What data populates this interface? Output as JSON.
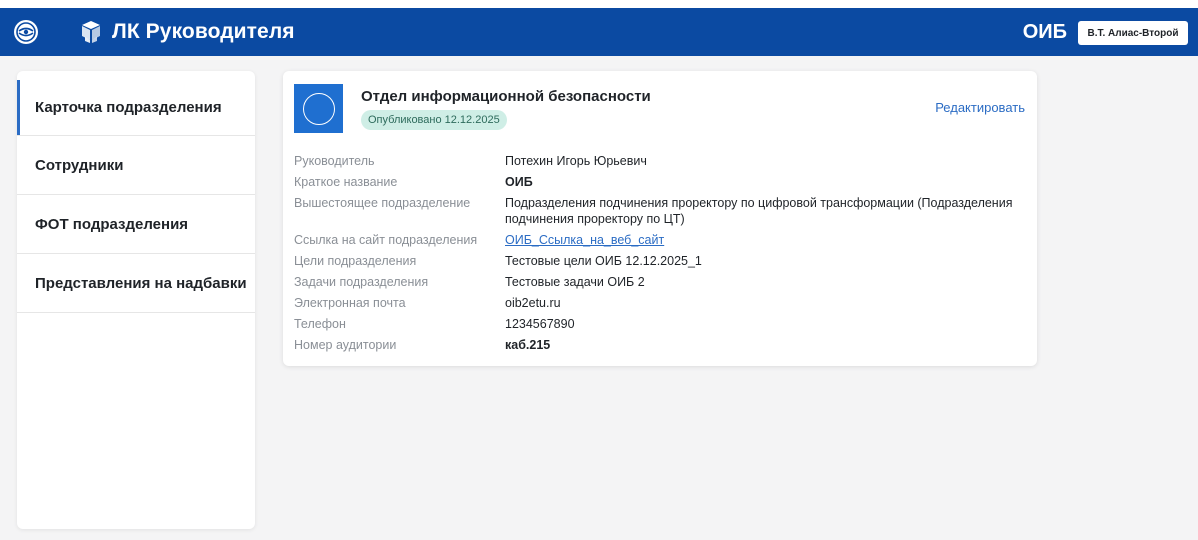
{
  "header": {
    "app_title": "ЛК Руководителя",
    "unit_code": "ОИБ",
    "user_name": "В.Т. Алиас-Второй",
    "brand_color": "#0b4aa2"
  },
  "sidebar": {
    "items": [
      {
        "label": "Карточка подразделения",
        "active": true
      },
      {
        "label": "Сотрудники"
      },
      {
        "label": "ФОТ подразделения"
      },
      {
        "label": "Представления на надбавки"
      }
    ]
  },
  "card": {
    "title": "Отдел информационной безопасности",
    "status_badge": "Опубликовано 12.12.2025",
    "edit_label": "Редактировать",
    "fields": [
      {
        "label": "Руководитель",
        "value": "Потехин Игорь Юрьевич"
      },
      {
        "label": "Краткое название",
        "value": "ОИБ"
      },
      {
        "label": "Вышестоящее подразделение",
        "value": "Подразделения подчинения проректору по цифровой трансформации (Подразделения подчинения проректору по ЦТ)"
      },
      {
        "label": "Ссылка на сайт подразделения",
        "value": "ОИБ_Ссылка_на_веб_сайт"
      },
      {
        "label": "Цели подразделения",
        "value": "Тестовые цели ОИБ 12.12.2025_1"
      },
      {
        "label": "Задачи подразделения",
        "value": "Тестовые задачи ОИБ 2"
      },
      {
        "label": "Электронная почта",
        "value": "oib2etu.ru"
      },
      {
        "label": "Телефон",
        "value": "1234567890"
      },
      {
        "label": "Номер аудитории",
        "value": "каб.215"
      }
    ]
  },
  "icons": {
    "university_logo": "university-logo-icon",
    "app_icon": "cubes-icon"
  }
}
